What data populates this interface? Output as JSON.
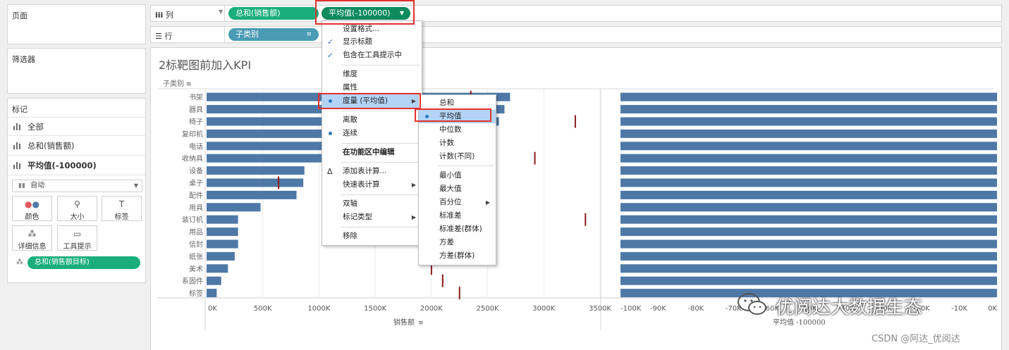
{
  "left": {
    "pages_title": "页面",
    "filters_title": "筛选器",
    "marks_title": "标记",
    "mark_rows": [
      {
        "label": "全部",
        "bold": false
      },
      {
        "label": "总和(销售额)",
        "bold": false
      },
      {
        "label": "平均值(-100000)",
        "bold": true
      }
    ],
    "mark_type_dropdown": "自动",
    "tiles": [
      {
        "label": "颜色",
        "icon": "color-dots-icon"
      },
      {
        "label": "大小",
        "icon": "size-icon"
      },
      {
        "label": "标签",
        "icon": "label-icon"
      },
      {
        "label": "详细信息",
        "icon": "detail-icon"
      },
      {
        "label": "工具提示",
        "icon": "tooltip-icon"
      }
    ],
    "detail_pill": "总和(销售额目标)"
  },
  "shelves": {
    "columns_label": "列",
    "rows_label": "行",
    "column_pills": [
      "总和(销售额)",
      "平均值(-100000)"
    ],
    "row_pill": "子类别"
  },
  "worksheet": {
    "title": "2标靶图前加入KPI",
    "row_header": "子类别",
    "left_axis_title": "销售额",
    "right_axis_title": "平均值 -100000"
  },
  "context_menu": {
    "items": [
      {
        "label": "设置格式...",
        "mark": ""
      },
      {
        "label": "显示标题",
        "mark": "check"
      },
      {
        "label": "包含在工具提示中",
        "mark": "check"
      },
      {
        "label": "维度",
        "mark": ""
      },
      {
        "label": "属性",
        "mark": ""
      },
      {
        "label": "度量 (平均值)",
        "mark": "dot",
        "submenu": true,
        "highlighted": true
      },
      {
        "label": "离散",
        "mark": ""
      },
      {
        "label": "连续",
        "mark": "dot"
      },
      {
        "label": "在功能区中编辑",
        "mark": "",
        "bold": true
      },
      {
        "label": "添加表计算...",
        "mark": "delta"
      },
      {
        "label": "快速表计算",
        "mark": "",
        "submenu": true
      },
      {
        "label": "双轴",
        "mark": ""
      },
      {
        "label": "标记类型",
        "mark": "",
        "submenu": true
      },
      {
        "label": "移除",
        "mark": ""
      }
    ]
  },
  "submenu": {
    "items": [
      {
        "label": "总和",
        "mark": ""
      },
      {
        "label": "平均值",
        "mark": "dot",
        "highlighted": true
      },
      {
        "label": "中位数",
        "mark": ""
      },
      {
        "label": "计数",
        "mark": ""
      },
      {
        "label": "计数(不同)",
        "mark": ""
      },
      {
        "label": "最小值",
        "mark": ""
      },
      {
        "label": "最大值",
        "mark": ""
      },
      {
        "label": "百分位",
        "mark": "",
        "submenu": true
      },
      {
        "label": "标准差",
        "mark": ""
      },
      {
        "label": "标准差(群体)",
        "mark": ""
      },
      {
        "label": "方差",
        "mark": ""
      },
      {
        "label": "方差(群体)",
        "mark": ""
      }
    ]
  },
  "chart_data": {
    "type": "bar",
    "categories": [
      "书架",
      "器具",
      "椅子",
      "复印机",
      "电话",
      "收纳具",
      "设备",
      "桌子",
      "配件",
      "用具",
      "装订机",
      "用品",
      "信封",
      "纸张",
      "美术",
      "系固件",
      "标签"
    ],
    "series": [
      {
        "name": "总和(销售额)",
        "values": [
          2700000,
          2650000,
          2600000,
          2550000,
          2400000,
          2300000,
          870000,
          860000,
          800000,
          480000,
          280000,
          280000,
          280000,
          250000,
          190000,
          130000,
          90000
        ]
      },
      {
        "name": "总和(销售额目标)",
        "values": [
          2350000,
          2200000,
          3280000,
          2150000,
          2300000,
          2920000,
          2200000,
          640000,
          2150000,
          2100000,
          3370000,
          2250000,
          2000000,
          2100000,
          2000000,
          2100000,
          2250000
        ]
      },
      {
        "name": "平均值(-100000)",
        "values": [
          -100000,
          -100000,
          -100000,
          -100000,
          -100000,
          -100000,
          -100000,
          -100000,
          -100000,
          -100000,
          -100000,
          -100000,
          -100000,
          -100000,
          -100000,
          -100000,
          -100000
        ]
      }
    ],
    "left_axis": {
      "ticks": [
        "0K",
        "500K",
        "1000K",
        "1500K",
        "2000K",
        "2500K",
        "3000K",
        "3500K"
      ],
      "range": [
        0,
        3500000
      ]
    },
    "right_axis": {
      "ticks": [
        "-100K",
        "-90K",
        "-80K",
        "-70K",
        "-60K",
        "-50K",
        "-40K",
        "-30K",
        "-20K",
        "-10K",
        "0K"
      ],
      "range": [
        -100000,
        0
      ]
    },
    "bar_color": "#4e79a7",
    "target_color": "#8b1a1a"
  },
  "watermark": {
    "text": "优阅达大数据生态",
    "credit": "CSDN @阿达_优阅达"
  },
  "colors": {
    "accent_red": "#e3302f",
    "pill_green": "#1aae7d",
    "pill_teal": "#4a9bb4"
  }
}
